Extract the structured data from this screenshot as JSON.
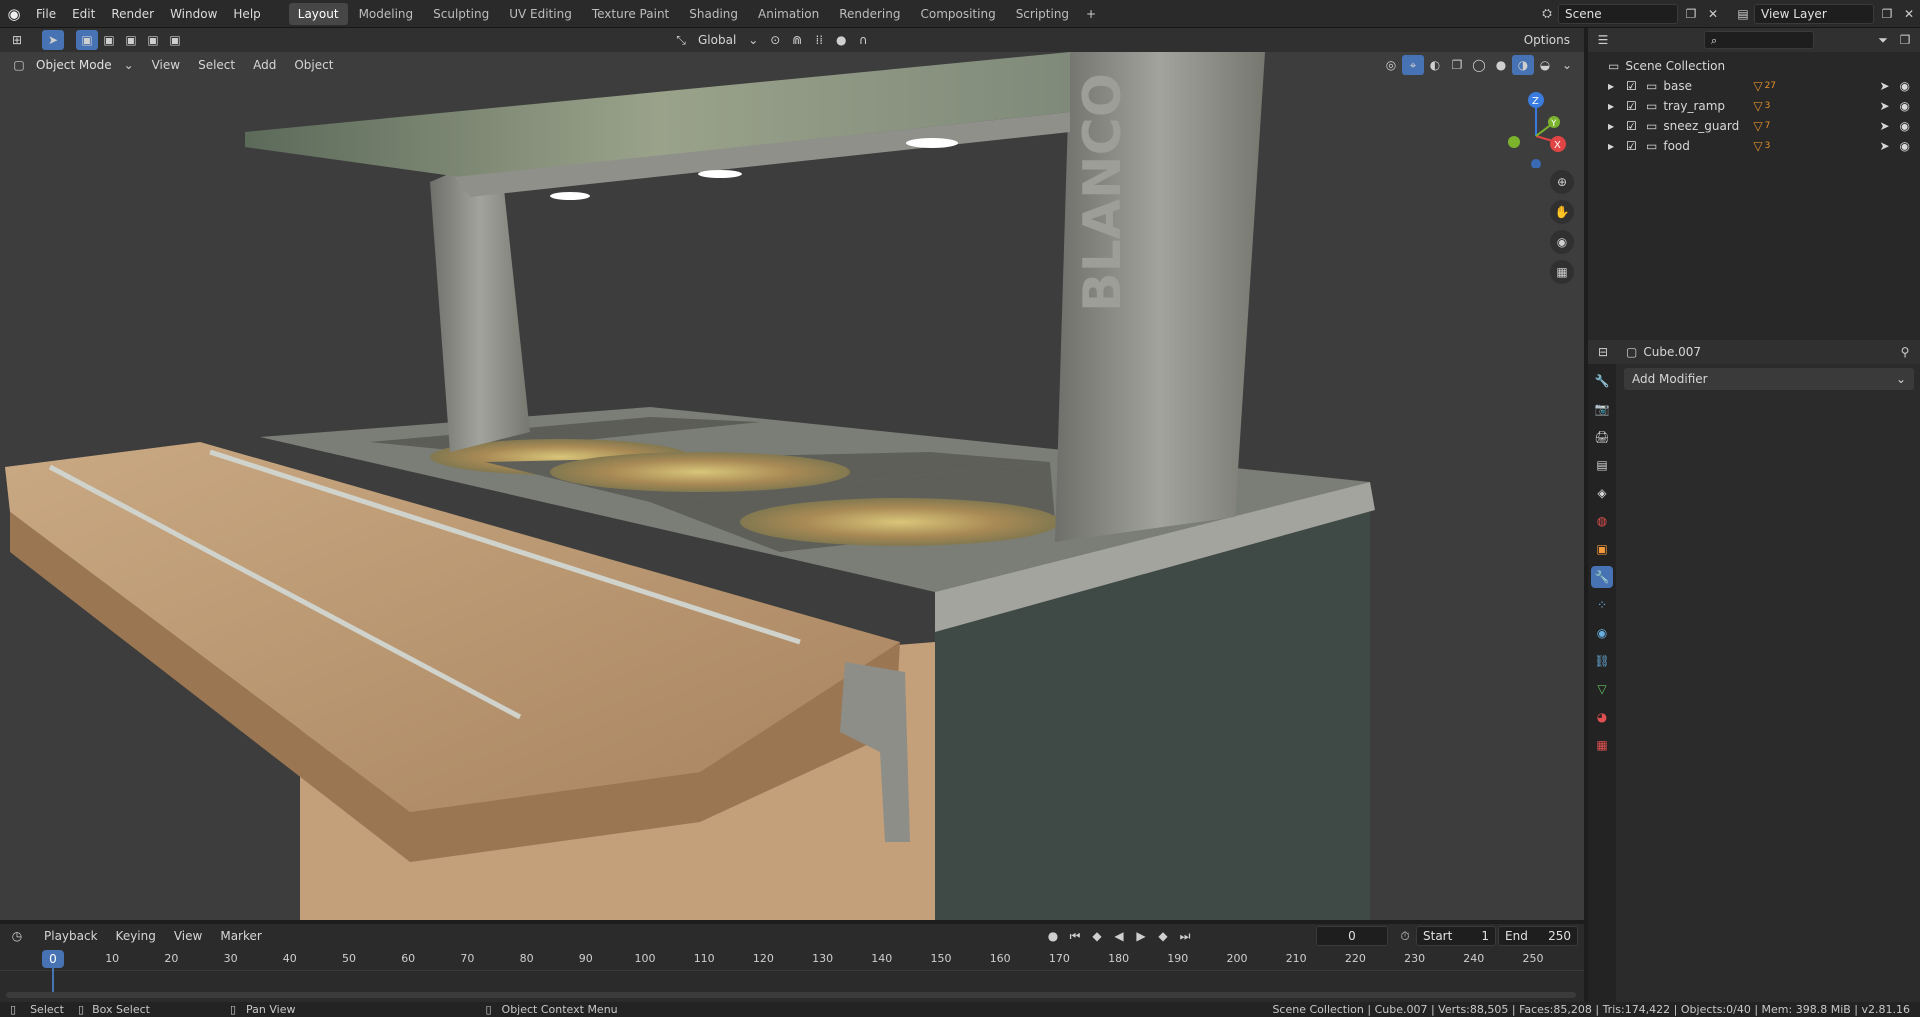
{
  "menu": [
    "File",
    "Edit",
    "Render",
    "Window",
    "Help"
  ],
  "workspaces": [
    "Layout",
    "Modeling",
    "Sculpting",
    "UV Editing",
    "Texture Paint",
    "Shading",
    "Animation",
    "Rendering",
    "Compositing",
    "Scripting"
  ],
  "active_workspace": "Layout",
  "scene_name": "Scene",
  "view_layer": "View Layer",
  "toolbar": {
    "transform_orientation": "Global",
    "options_label": "Options"
  },
  "viewport_header": {
    "mode": "Object Mode",
    "menus": [
      "View",
      "Select",
      "Add",
      "Object"
    ]
  },
  "gizmo": {
    "z": "Z",
    "x": "X",
    "y": "Y"
  },
  "viewport_text": {
    "sign": "BLANCO"
  },
  "outliner": {
    "root": "Scene Collection",
    "collections": [
      {
        "name": "base",
        "badge": "27"
      },
      {
        "name": "tray_ramp",
        "badge": "3"
      },
      {
        "name": "sneez_guard",
        "badge": "7"
      },
      {
        "name": "food",
        "badge": "3"
      }
    ]
  },
  "properties": {
    "object_name": "Cube.007",
    "add_modifier": "Add Modifier"
  },
  "timeline": {
    "menus": [
      "Playback",
      "Keying",
      "View",
      "Marker"
    ],
    "current_frame": "0",
    "start_label": "Start",
    "start_value": "1",
    "end_label": "End",
    "end_value": "250",
    "ticks": [
      "0",
      "10",
      "20",
      "30",
      "40",
      "50",
      "60",
      "70",
      "80",
      "90",
      "100",
      "110",
      "120",
      "130",
      "140",
      "150",
      "160",
      "170",
      "180",
      "190",
      "200",
      "210",
      "220",
      "230",
      "240",
      "250"
    ]
  },
  "statusbar": {
    "select": "Select",
    "box_select": "Box Select",
    "pan_view": "Pan View",
    "context_menu": "Object Context Menu",
    "stats": "Scene Collection | Cube.007 | Verts:88,505 | Faces:85,208 | Tris:174,422 | Objects:0/40 | Mem: 398.8 MiB | v2.81.16"
  },
  "colors": {
    "accent": "#4772b3",
    "header": "#2a2a2a",
    "viewport": "#3d3d3d"
  }
}
